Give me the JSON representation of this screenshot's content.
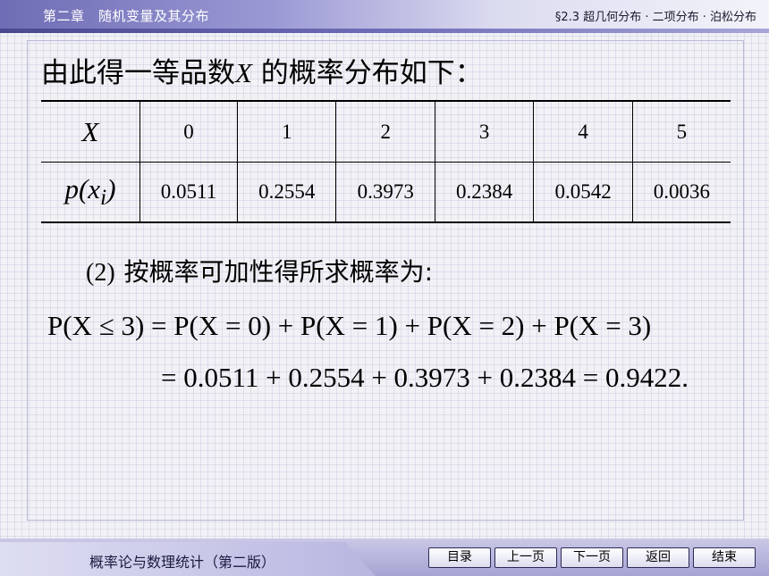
{
  "header": {
    "chapter": "第二章　随机变量及其分布",
    "section": "§2.3  超几何分布 · 二项分布 · 泊松分布"
  },
  "content": {
    "intro_text_before": "由此得一等品数",
    "intro_var": "X",
    "intro_text_after": " 的概率分布如下：",
    "table": {
      "x_header": "X",
      "p_header_fn": "p",
      "p_header_var": "x",
      "p_header_sub": "i",
      "x_values": [
        "0",
        "1",
        "2",
        "3",
        "4",
        "5"
      ],
      "p_values": [
        "0.0511",
        "0.2554",
        "0.3973",
        "0.2384",
        "0.0542",
        "0.0036"
      ]
    },
    "part2_label": "(2)",
    "part2_text": "按概率可加性得所求概率为:",
    "equation_line1": "P(X ≤ 3) = P(X = 0) + P(X = 1) + P(X = 2) + P(X = 3)",
    "equation_line2": "= 0.0511 + 0.2554 + 0.3973 + 0.2384 = 0.9422."
  },
  "footer": {
    "book_title": "概率论与数理统计（第二版）",
    "nav": {
      "contents": "目录",
      "prev": "上一页",
      "next": "下一页",
      "back": "返回",
      "end": "结束"
    }
  }
}
